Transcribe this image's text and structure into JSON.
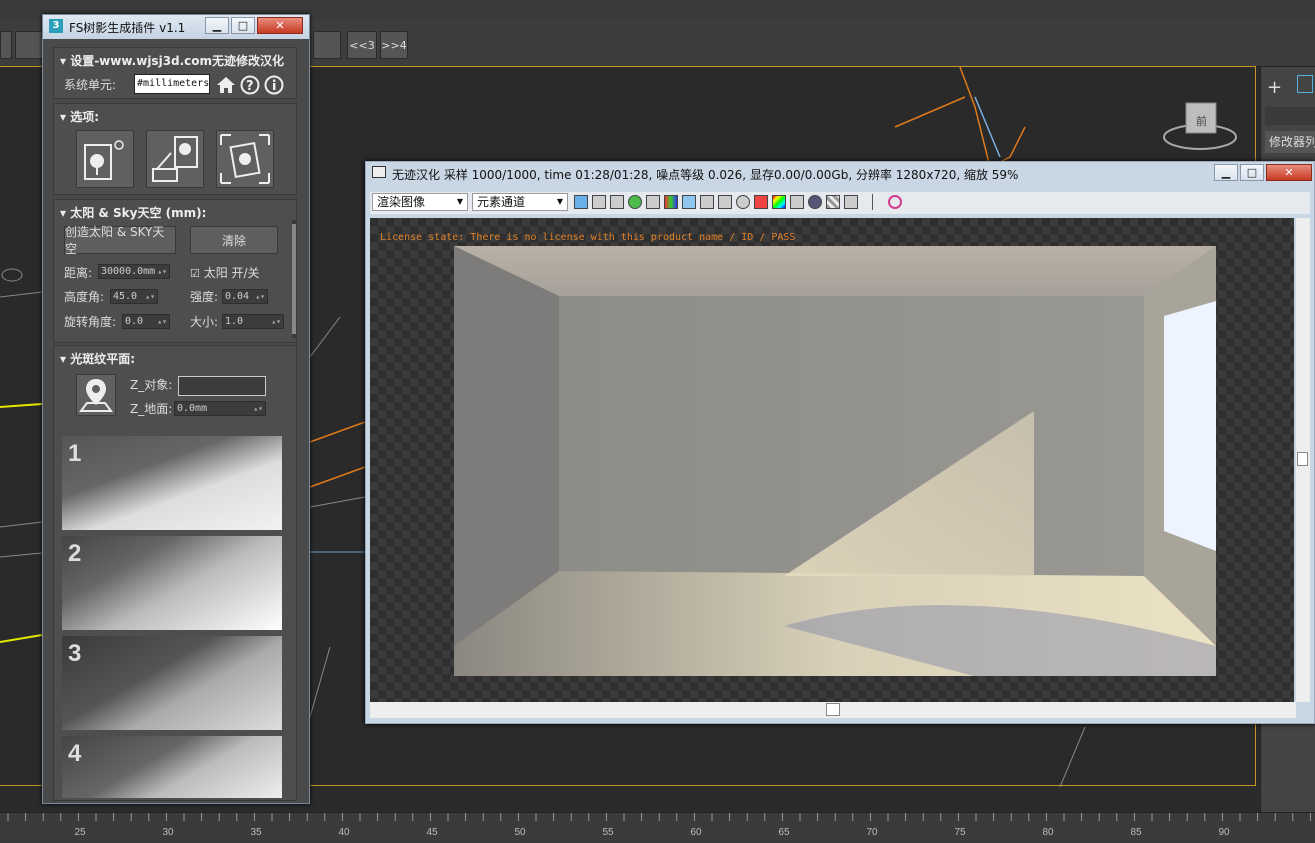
{
  "plugin": {
    "title": "FS树影生成插件 v1.1",
    "settings": {
      "header": "设置-www.wjsj3d.com无迹修改汉化",
      "unit_label": "系统单元:",
      "unit_value": "#millimeters"
    },
    "options": {
      "header": "选项:"
    },
    "sun": {
      "header": "太阳 & Sky天空 (mm):",
      "create_button": "创造太阳 & SKY天空",
      "clear_button": "清除",
      "distance_label": "距离:",
      "distance_value": "30000.0mm",
      "sun_toggle_label": "太阳 开/关",
      "altitude_label": "高度角:",
      "altitude_value": "45.0",
      "intensity_label": "强度:",
      "intensity_value": "0.04",
      "rotation_label": "旋转角度:",
      "rotation_value": "0.0",
      "size_label": "大小:",
      "size_value": "1.0"
    },
    "caustics": {
      "header": "光斑纹平面:",
      "z_object_label": "Z_对象:",
      "z_ground_label": "Z_地面:",
      "z_ground_value": "0.0mm"
    },
    "thumbnails": [
      "1",
      "2",
      "3",
      "4"
    ]
  },
  "render": {
    "title": "无迹汉化  采样 1000/1000, time 01:28/01:28, 噪点等级 0.026, 显存0.00/0.00Gb, 分辨率 1280x720, 缩放 59%",
    "channel_dropdown": "渲染图像",
    "element_dropdown": "元素通道",
    "license_text": "License state: There is no license with this product name / ID / PASS"
  },
  "host": {
    "nav_prev": "<<3",
    "nav_next": ">>4",
    "modifier_label": "修改器列",
    "ruler_ticks": [
      "25",
      "30",
      "35",
      "40",
      "45",
      "50",
      "55",
      "60",
      "65",
      "70",
      "75",
      "80",
      "85",
      "90"
    ]
  },
  "colors": {
    "viewport_border": "#c8952c",
    "license_text": "#e0802a"
  }
}
